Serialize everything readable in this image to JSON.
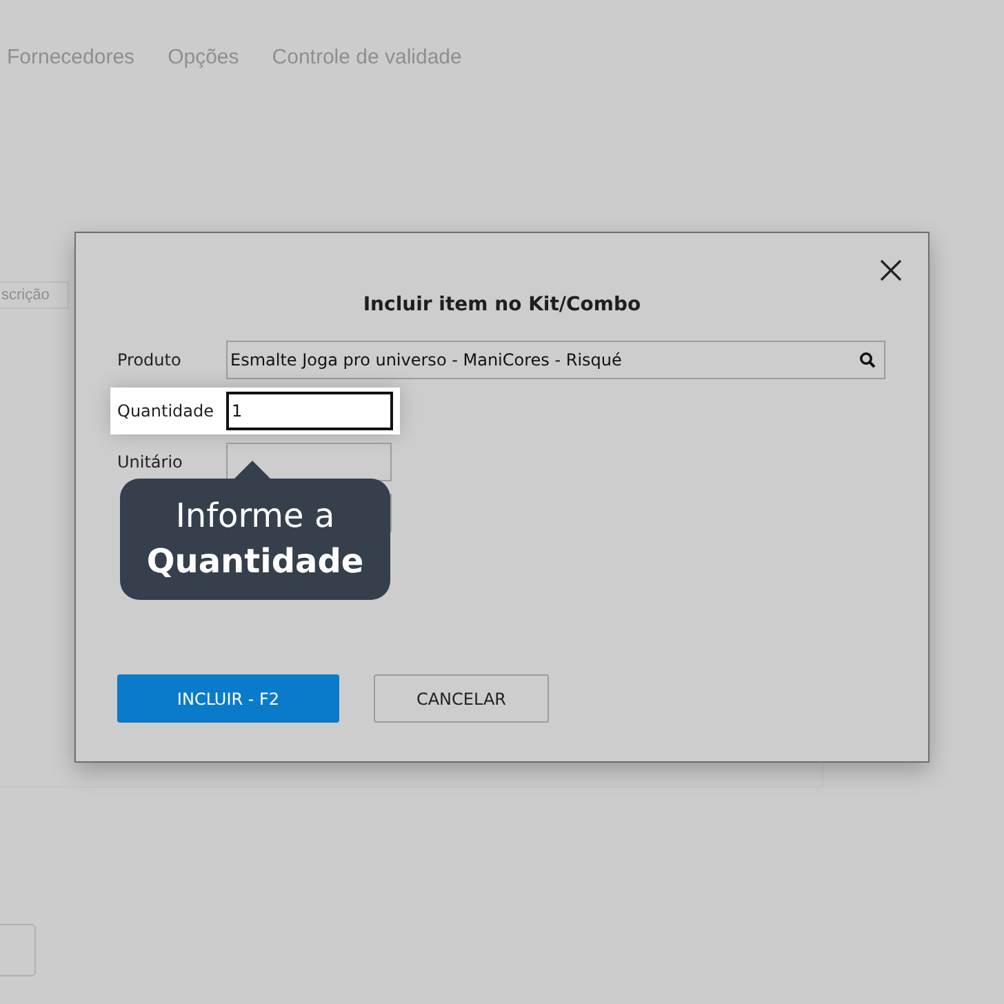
{
  "background": {
    "tabs": [
      {
        "label": "Fornecedores"
      },
      {
        "label": "Opções"
      },
      {
        "label": "Controle de validade"
      }
    ],
    "field_hint": "scrição"
  },
  "dialog": {
    "title": "Incluir item no Kit/Combo",
    "fields": [
      {
        "label": "Produto",
        "kind": "search",
        "value": "Esmalte Joga pro universo - ManiCores - Risqué",
        "highlighted": false
      },
      {
        "label": "Quantidade",
        "kind": "short",
        "value": "1",
        "highlighted": true
      },
      {
        "label": "Unitário",
        "kind": "short",
        "highlighted": false
      },
      {
        "kind": "short",
        "highlighted": false
      }
    ],
    "buttons": [
      {
        "label": "INCLUIR - F2",
        "kind": "primary"
      },
      {
        "label": "CANCELAR",
        "kind": "secondary"
      }
    ]
  },
  "tooltip": {
    "text": "Informe a **Quantidade**"
  }
}
